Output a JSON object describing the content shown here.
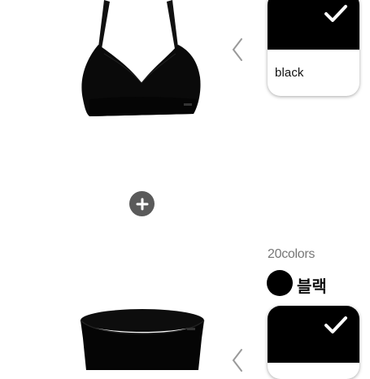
{
  "product_top": {
    "image_alt": "black bra",
    "color_label": "black",
    "swatch_color": "#000000"
  },
  "product_bottom": {
    "image_alt": "black briefs",
    "swatch_color": "#000000"
  },
  "colors": {
    "count_label": "20colors",
    "selected_name": "블랙",
    "selected_color": "#000000"
  },
  "icons": {
    "prev_arrow": "chevron-left-icon",
    "check": "check-icon",
    "plus": "plus-icon"
  },
  "accent": {
    "check": "#ffffff",
    "plus_bg": "#5a5a5a",
    "arrow": "#999999",
    "count_text": "#777777"
  }
}
